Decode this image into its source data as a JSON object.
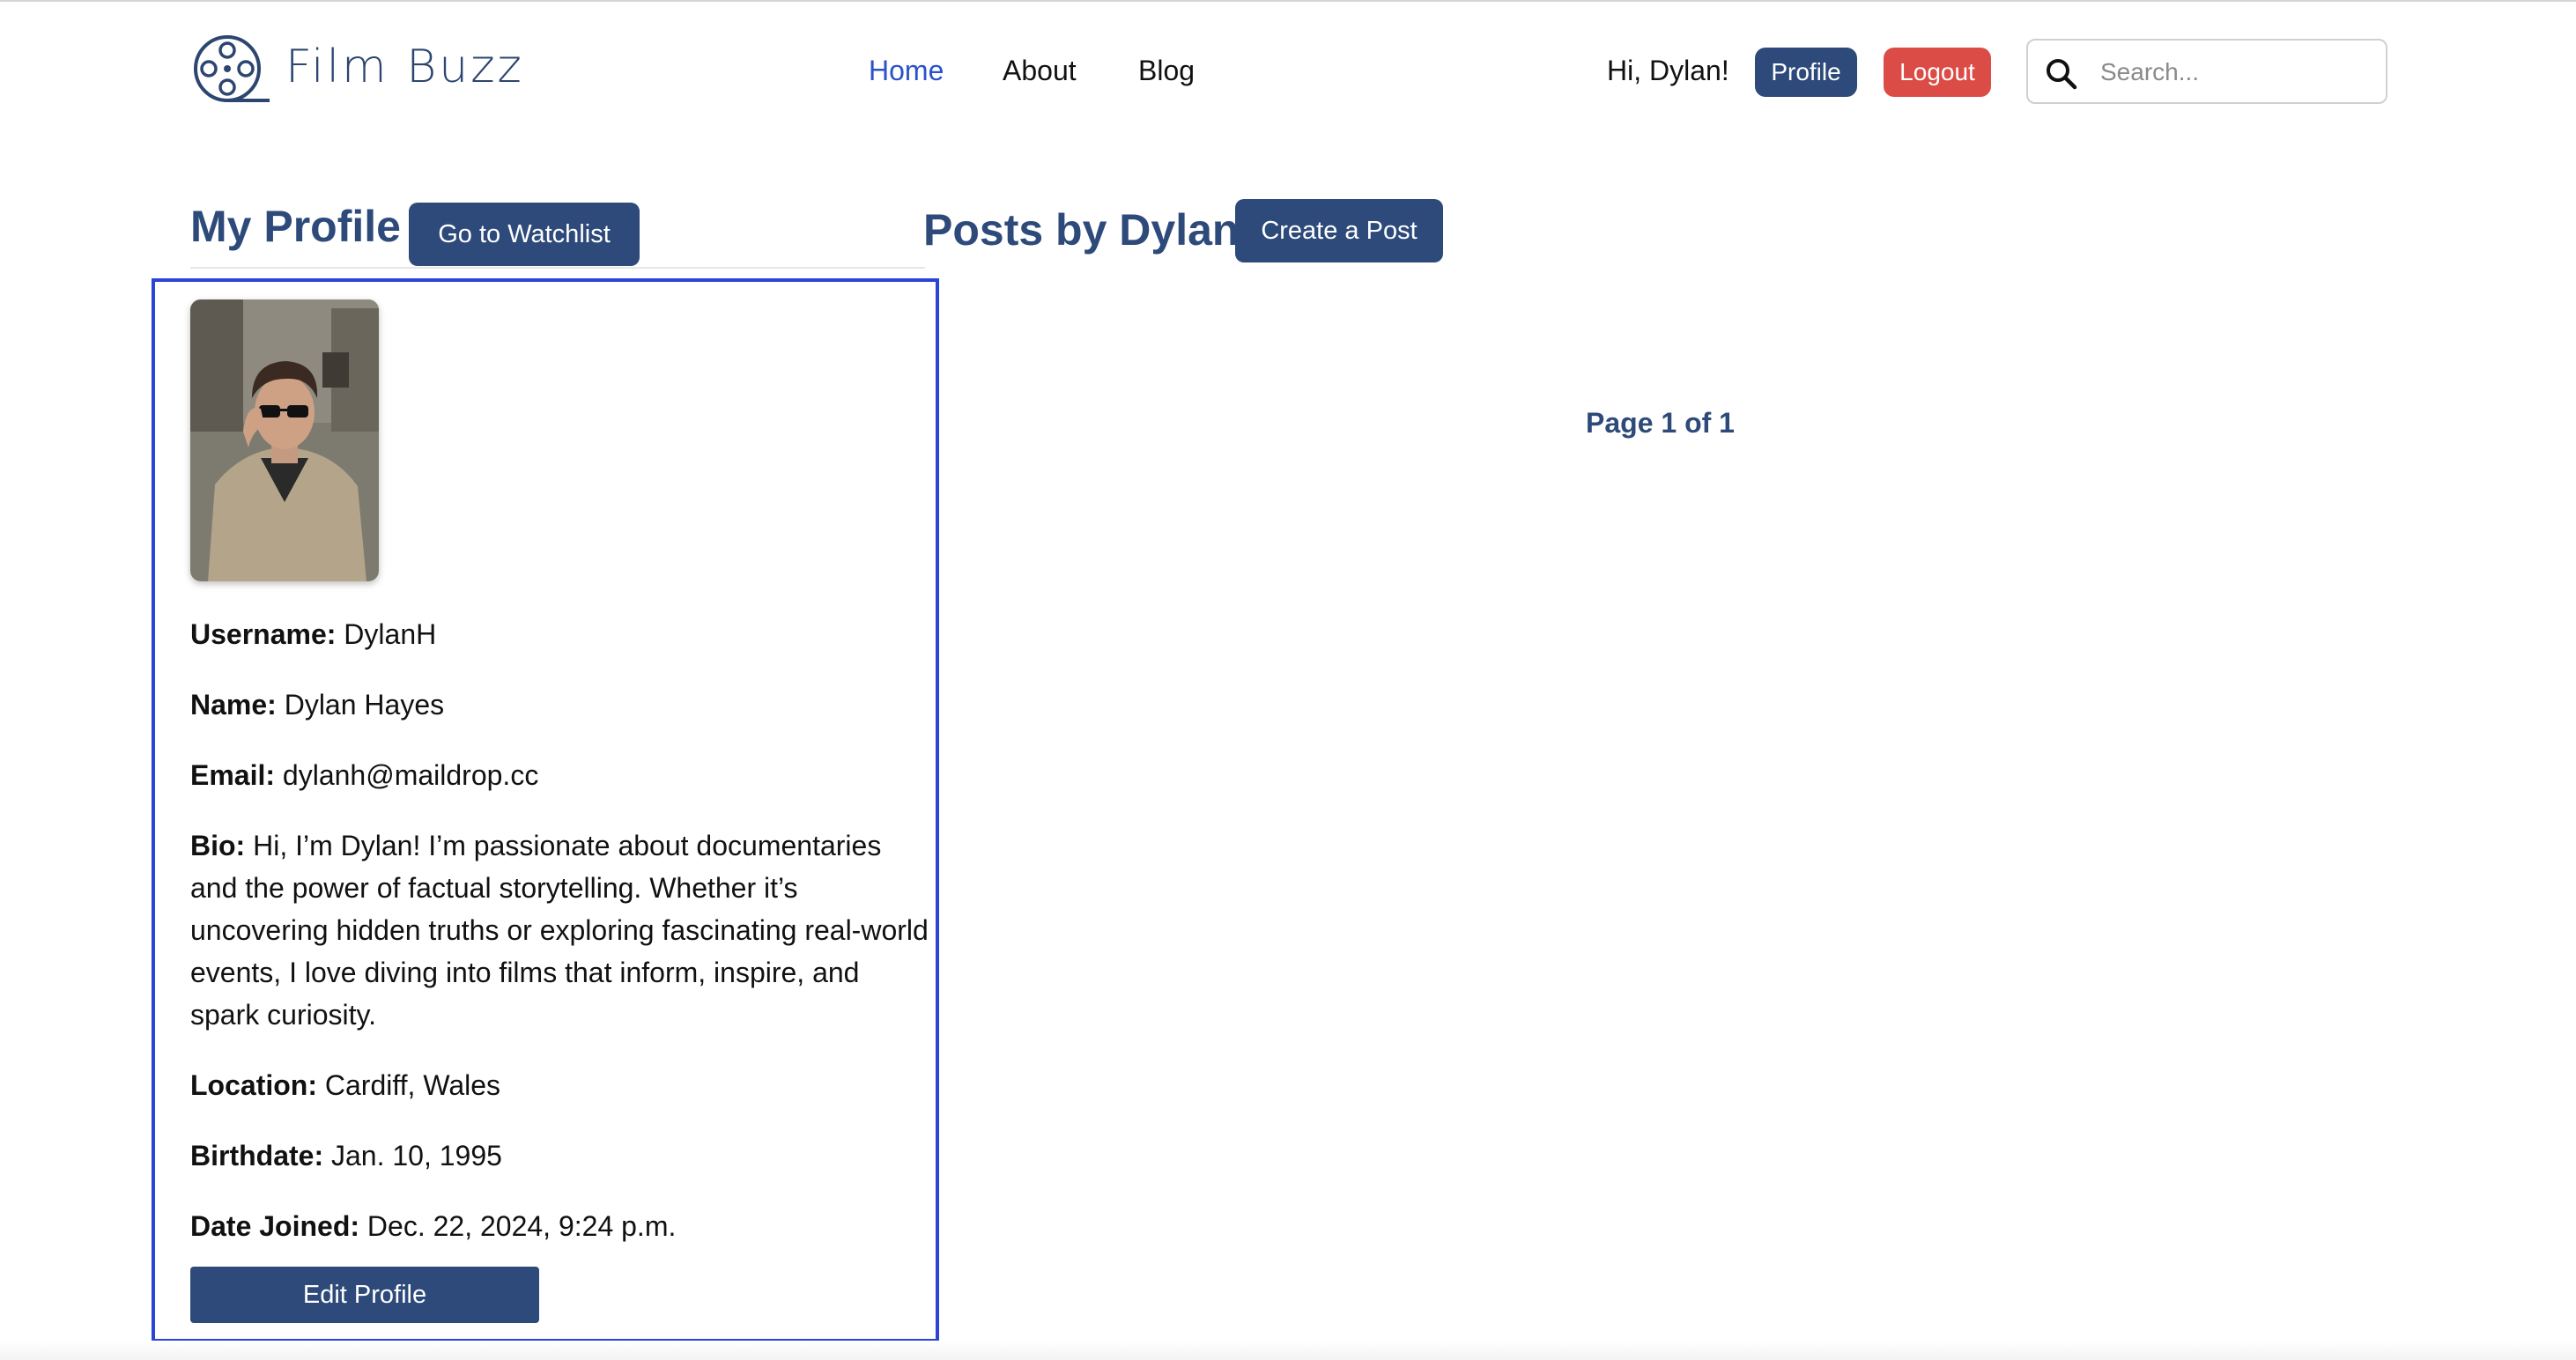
{
  "nav": {
    "brand": "Film Buzz",
    "links": [
      "Home",
      "About",
      "Blog"
    ],
    "active": "Home",
    "greeting": "Hi, Dylan!",
    "profile_label": "Profile",
    "logout_label": "Logout",
    "search_placeholder": "Search..."
  },
  "profile": {
    "heading": "My Profile",
    "watchlist_button": "Go to Watchlist",
    "fields": [
      {
        "label": "Username:",
        "value": "DylanH"
      },
      {
        "label": "Name:",
        "value": "Dylan Hayes"
      },
      {
        "label": "Email:",
        "value": "dylanh@maildrop.cc"
      },
      {
        "label": "Bio:",
        "value": "Hi, I’m Dylan! I’m passionate about documentaries and the power of factual storytelling. Whether it’s uncovering hidden truths or exploring fascinating real-world events, I love diving into films that inform, inspire, and spark curiosity."
      },
      {
        "label": "Location:",
        "value": "Cardiff, Wales"
      },
      {
        "label": "Birthdate:",
        "value": "Jan. 10, 1995"
      },
      {
        "label": "Date Joined:",
        "value": "Dec. 22, 2024, 9:24 p.m."
      }
    ],
    "edit_button": "Edit Profile"
  },
  "posts": {
    "heading": "Posts by Dylan",
    "create_button": "Create a Post",
    "pagination": "Page 1 of 1"
  },
  "colors": {
    "primary": "#2d4a7a",
    "nav_active": "#2a52c9",
    "danger": "#dc4c46",
    "card_border": "#2a45d6"
  },
  "icons": {
    "logo": "film-reel-icon",
    "search": "search-icon"
  }
}
